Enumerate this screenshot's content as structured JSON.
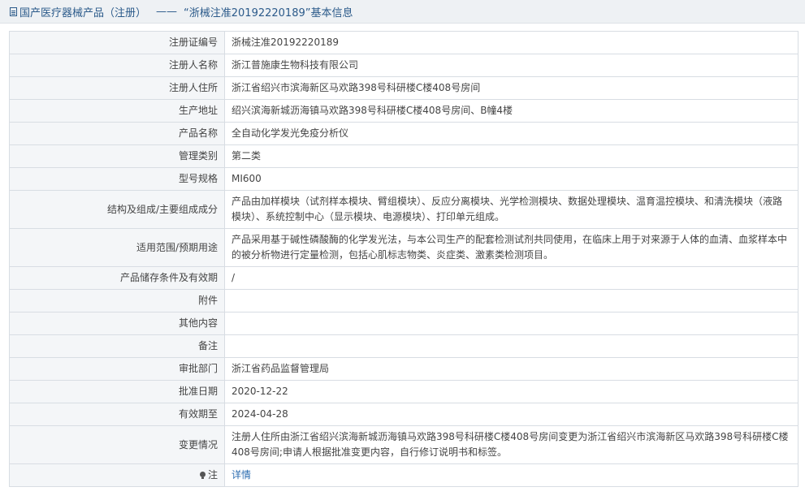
{
  "header": {
    "breadcrumb": "国产医疗器械产品（注册）",
    "separator": "——",
    "title": "“浙械注准20192220189”基本信息"
  },
  "rows": [
    {
      "label": "注册证编号",
      "value": "浙械注准20192220189"
    },
    {
      "label": "注册人名称",
      "value": "浙江普施康生物科技有限公司"
    },
    {
      "label": "注册人住所",
      "value": "浙江省绍兴市滨海新区马欢路398号科研楼C楼408号房间"
    },
    {
      "label": "生产地址",
      "value": "绍兴滨海新城沥海镇马欢路398号科研楼C楼408号房间、B幢4楼"
    },
    {
      "label": "产品名称",
      "value": "全自动化学发光免疫分析仪"
    },
    {
      "label": "管理类别",
      "value": "第二类"
    },
    {
      "label": "型号规格",
      "value": "MI600"
    },
    {
      "label": "结构及组成/主要组成成分",
      "value": "产品由加样模块（试剂样本模块、臂组模块）、反应分离模块、光学检测模块、数据处理模块、温育温控模块、和清洗模块（液路模块）、系统控制中心（显示模块、电源模块）、打印单元组成。"
    },
    {
      "label": "适用范围/预期用途",
      "value": "产品采用基于碱性磷酸酶的化学发光法，与本公司生产的配套检测试剂共同使用，在临床上用于对来源于人体的血清、血浆样本中的被分析物进行定量检测，包括心肌标志物类、炎症类、激素类检测项目。"
    },
    {
      "label": "产品储存条件及有效期",
      "value": "/"
    },
    {
      "label": "附件",
      "value": ""
    },
    {
      "label": "其他内容",
      "value": ""
    },
    {
      "label": "备注",
      "value": ""
    },
    {
      "label": "审批部门",
      "value": "浙江省药品监督管理局"
    },
    {
      "label": "批准日期",
      "value": "2020-12-22"
    },
    {
      "label": "有效期至",
      "value": "2024-04-28"
    },
    {
      "label": "变更情况",
      "value": "注册人住所由浙江省绍兴滨海新城沥海镇马欢路398号科研楼C楼408号房间变更为浙江省绍兴市滨海新区马欢路398号科研楼C楼408号房间;申请人根据批准变更内容，自行修订说明书和标签。"
    }
  ],
  "note": {
    "label": "注",
    "link": "详情"
  }
}
